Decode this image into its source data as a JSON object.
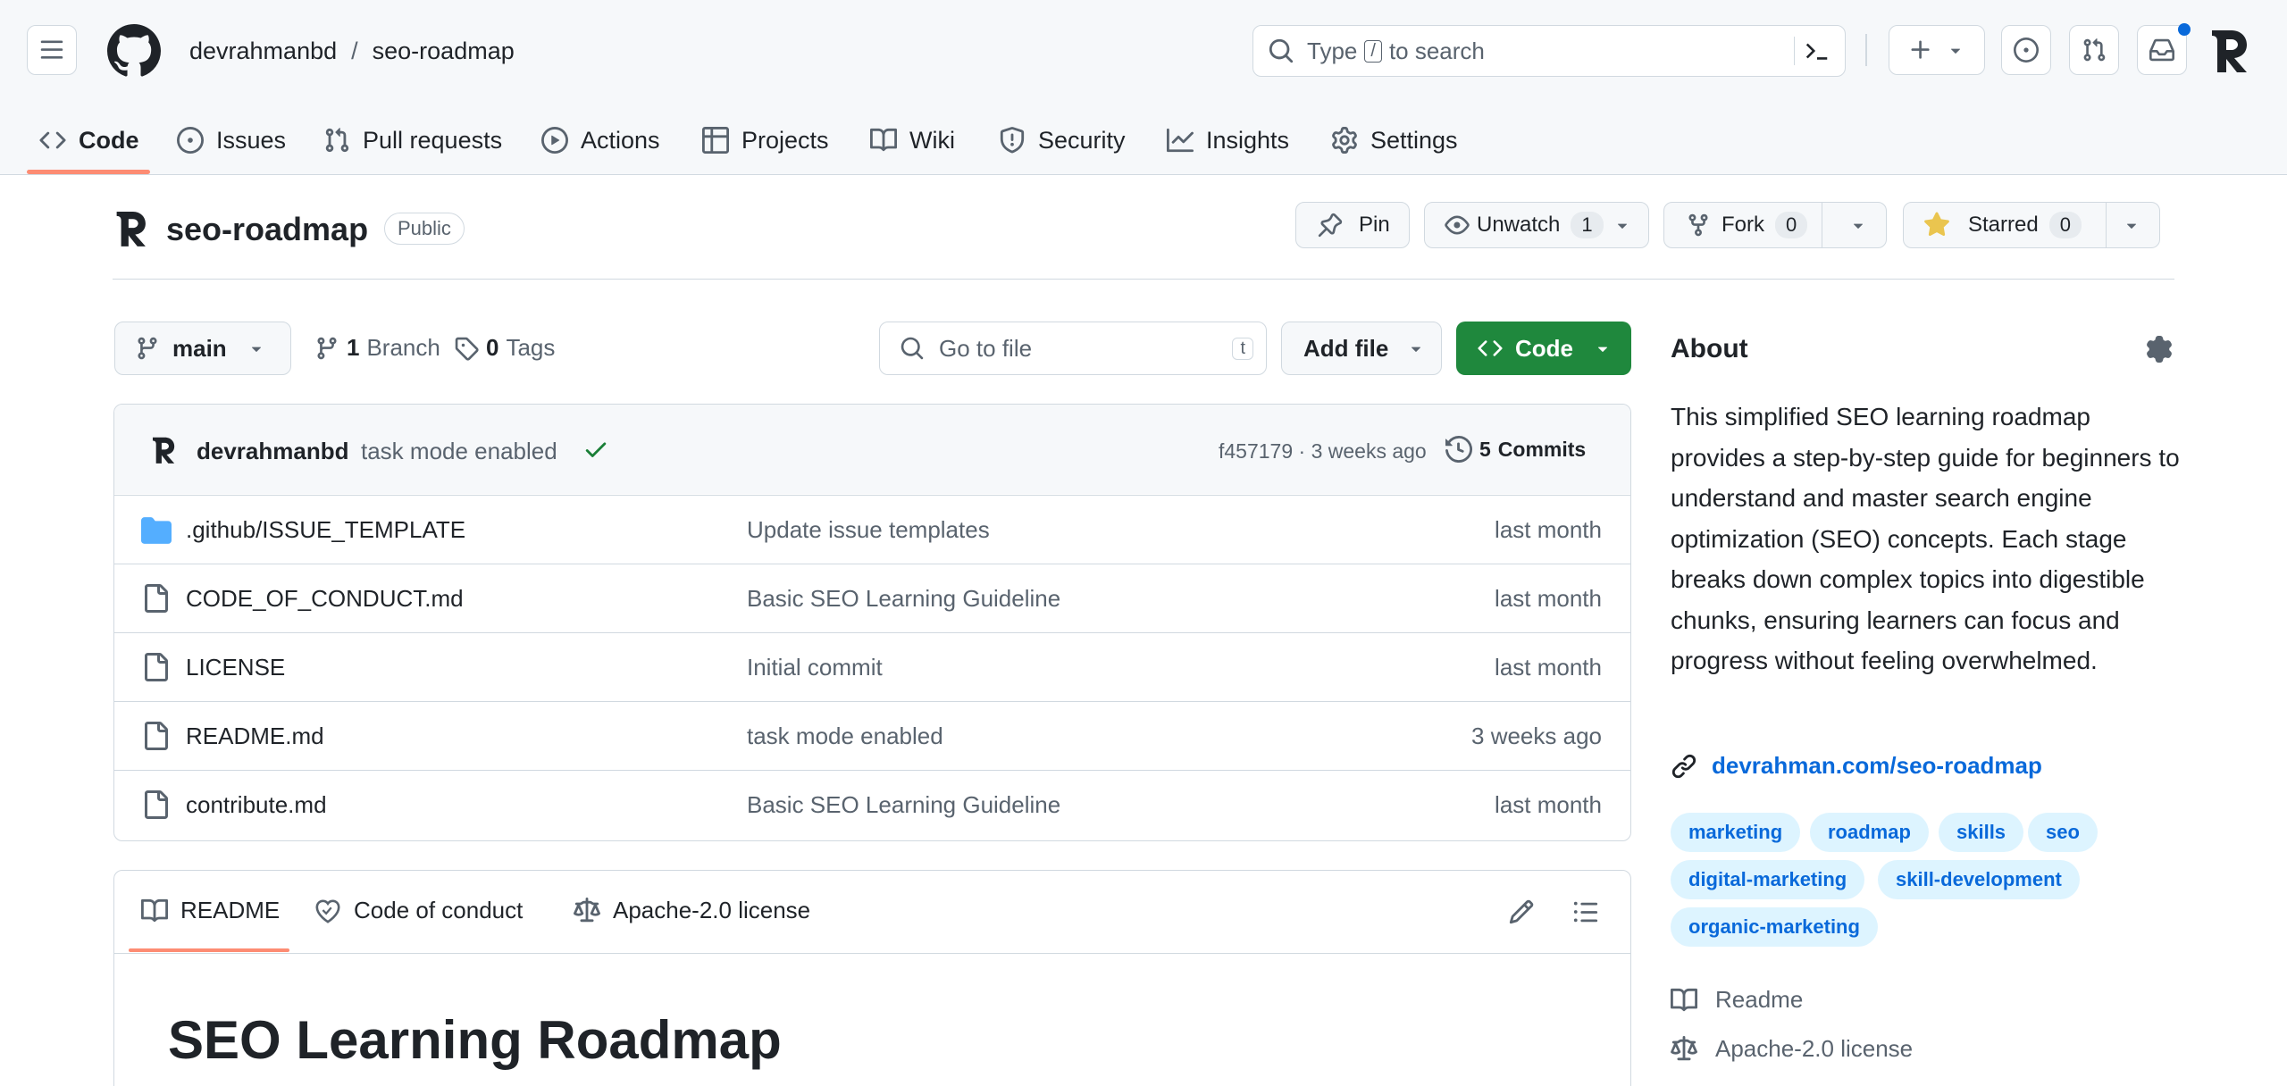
{
  "header": {
    "owner": "devrahmanbd",
    "separator": "/",
    "repo": "seo-roadmap",
    "search_prefix": "Type",
    "search_key": "/",
    "search_suffix": "to search"
  },
  "tabs": [
    {
      "label": "Code",
      "icon": "code-icon"
    },
    {
      "label": "Issues",
      "icon": "issue-icon"
    },
    {
      "label": "Pull requests",
      "icon": "pull-request-icon"
    },
    {
      "label": "Actions",
      "icon": "play-icon"
    },
    {
      "label": "Projects",
      "icon": "table-icon"
    },
    {
      "label": "Wiki",
      "icon": "book-icon"
    },
    {
      "label": "Security",
      "icon": "shield-icon"
    },
    {
      "label": "Insights",
      "icon": "graph-icon"
    },
    {
      "label": "Settings",
      "icon": "gear-icon"
    }
  ],
  "repo_header": {
    "name": "seo-roadmap",
    "visibility": "Public",
    "pin_label": "Pin",
    "watch_label": "Unwatch",
    "watch_count": "1",
    "fork_label": "Fork",
    "fork_count": "0",
    "star_label": "Starred",
    "star_count": "0"
  },
  "toolbar": {
    "branch": "main",
    "branch_count": "1",
    "branch_label": "Branch",
    "tag_count": "0",
    "tag_label": "Tags",
    "goto_placeholder": "Go to file",
    "goto_key": "t",
    "add_file": "Add file",
    "code_button": "Code"
  },
  "commit": {
    "author": "devrahmanbd",
    "message": "task mode enabled",
    "hash_time": "f457179 · 3 weeks ago",
    "commits_count": "5",
    "commits_label": "Commits"
  },
  "files": [
    {
      "type": "folder",
      "name": ".github/ISSUE_TEMPLATE",
      "message": "Update issue templates",
      "date": "last month"
    },
    {
      "type": "file",
      "name": "CODE_OF_CONDUCT.md",
      "message": "Basic SEO Learning Guideline",
      "date": "last month"
    },
    {
      "type": "file",
      "name": "LICENSE",
      "message": "Initial commit",
      "date": "last month"
    },
    {
      "type": "file",
      "name": "README.md",
      "message": "task mode enabled",
      "date": "3 weeks ago"
    },
    {
      "type": "file",
      "name": "contribute.md",
      "message": "Basic SEO Learning Guideline",
      "date": "last month"
    }
  ],
  "readme": {
    "tabs": [
      {
        "label": "README",
        "icon": "book-icon"
      },
      {
        "label": "Code of conduct",
        "icon": "heart-icon"
      },
      {
        "label": "Apache-2.0 license",
        "icon": "law-icon"
      }
    ],
    "heading": "SEO Learning Roadmap"
  },
  "about": {
    "title": "About",
    "description": "This simplified SEO learning roadmap provides a step-by-step guide for beginners to understand and master search engine optimization (SEO) concepts. Each stage breaks down complex topics into digestible chunks, ensuring learners can focus and progress without feeling overwhelmed.",
    "link": "devrahman.com/seo-roadmap",
    "topics": [
      "marketing",
      "roadmap",
      "skills",
      "seo",
      "digital-marketing",
      "skill-development",
      "organic-marketing"
    ],
    "readme_label": "Readme",
    "license_label": "Apache-2.0 license"
  },
  "colors": {
    "accent": "#0969da",
    "green": "#1f883d",
    "star": "#eac54f",
    "tab_underline": "#fd8c73",
    "folder": "#54aeff"
  }
}
